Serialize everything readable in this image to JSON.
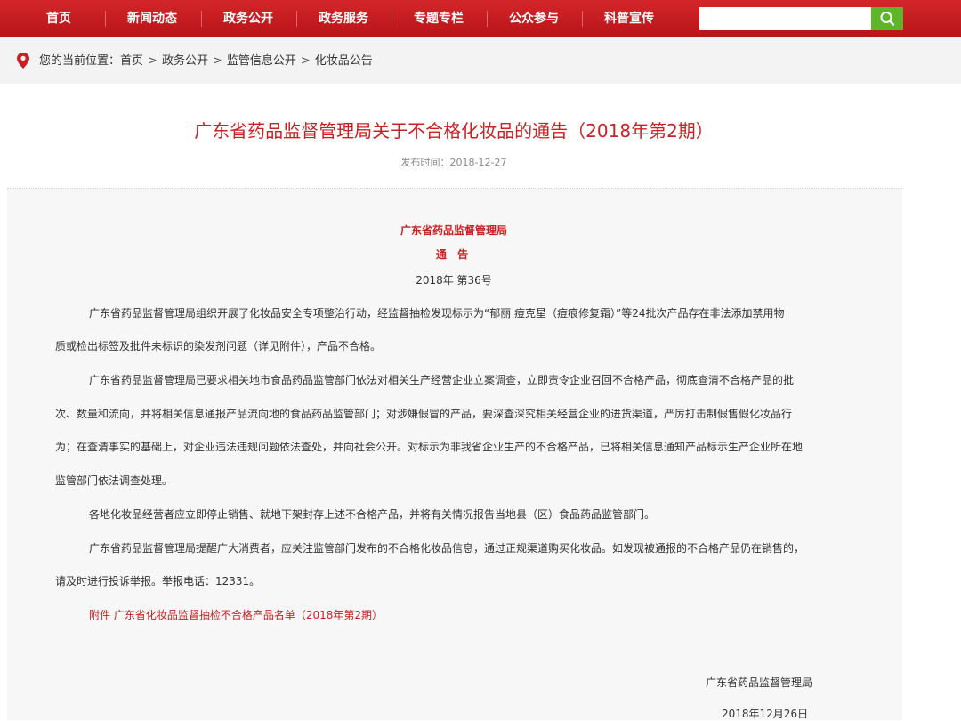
{
  "nav": {
    "items": [
      "首页",
      "新闻动态",
      "政务公开",
      "政务服务",
      "专题专栏",
      "公众参与",
      "科普宣传"
    ],
    "search_placeholder": ""
  },
  "breadcrumb": {
    "prefix": "您的当前位置：",
    "items": [
      "首页",
      "政务公开",
      "监管信息公开",
      "化妆品公告"
    ]
  },
  "article": {
    "title": "广东省药品监督管理局关于不合格化妆品的通告（2018年第2期）",
    "publish_time": "发布时间：2018-12-27",
    "org": "广东省药品监督管理局",
    "notice": "通 告",
    "doc_no": "2018年 第36号",
    "lines": [
      "广东省药品监督管理局组织开展了化妆品安全专项整治行动，经监督抽检发现标示为“郁丽 痘克星（痘痕修复霜）”等24批次产品存在非法添加禁用物",
      "质或检出标签及批件未标识的染发剂问题（详见附件），产品不合格。",
      "广东省药品监督管理局已要求相关地市食品药品监管部门依法对相关生产经营企业立案调查，立即责令企业召回不合格产品，彻底查清不合格产品的批",
      "次、数量和流向，并将相关信息通报产品流向地的食品药品监管部门；对涉嫌假冒的产品，要深查深究相关经营企业的进货渠道，严厉打击制假售假化妆品行",
      "为；在查清事实的基础上，对企业违法违规问题依法查处，并向社会公开。对标示为非我省企业生产的不合格产品，已将相关信息通知产品标示生产企业所在地",
      "监管部门依法调查处理。",
      "各地化妆品经营者应立即停止销售、就地下架封存上述不合格产品，并将有关情况报告当地县（区）食品药品监管部门。",
      "广东省药品监督管理局提醒广大消费者，应关注监管部门发布的不合格化妆品信息，通过正规渠道购买化妆品。如发现被通报的不合格产品仍在销售的，",
      "请及时进行投诉举报。举报电话：12331。"
    ],
    "attachment": "附件 广东省化妆品监督抽检不合格产品名单（2018年第2期）",
    "signature_org": "广东省药品监督管理局",
    "signature_date": "2018年12月26日"
  },
  "colors": {
    "nav_red": "#c41c20",
    "title_red": "#cc1f22",
    "search_green": "#5eb52a"
  }
}
